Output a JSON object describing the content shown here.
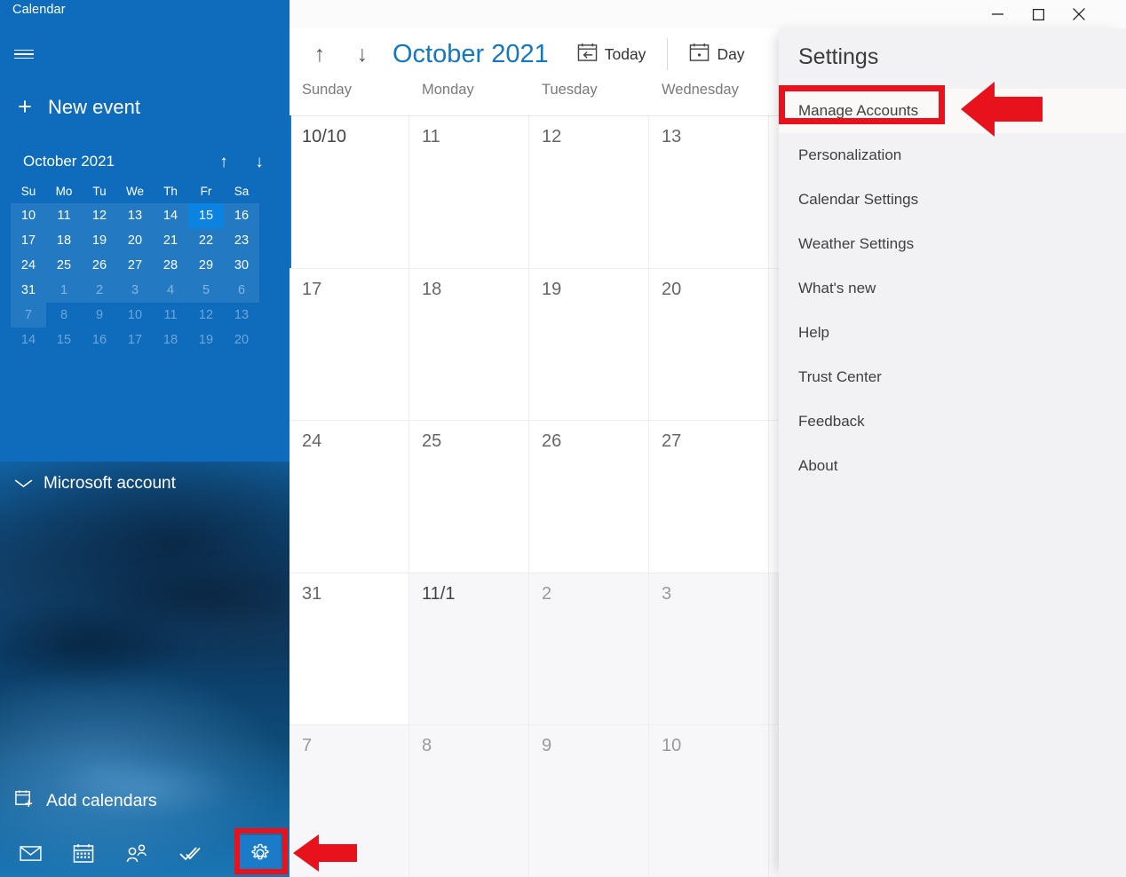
{
  "window": {
    "app_title": "Calendar",
    "controls": {
      "minimize": "—",
      "maximize": "□",
      "close": "✕"
    }
  },
  "sidebar": {
    "hamburger_label": "Menu",
    "new_event": {
      "icon": "plus-icon",
      "label": "New event"
    },
    "mini_calendar": {
      "month_label": "October 2021",
      "prev_icon": "↑",
      "next_icon": "↓",
      "weekday_headers": [
        "Su",
        "Mo",
        "Tu",
        "We",
        "Th",
        "Fr",
        "Sa"
      ],
      "today": "15",
      "weeks": [
        [
          {
            "d": "10",
            "state": "current"
          },
          {
            "d": "11",
            "state": "current"
          },
          {
            "d": "12",
            "state": "current"
          },
          {
            "d": "13",
            "state": "current"
          },
          {
            "d": "14",
            "state": "current"
          },
          {
            "d": "15",
            "state": "today"
          },
          {
            "d": "16",
            "state": "current"
          }
        ],
        [
          {
            "d": "17",
            "state": "current"
          },
          {
            "d": "18",
            "state": "current"
          },
          {
            "d": "19",
            "state": "current"
          },
          {
            "d": "20",
            "state": "current"
          },
          {
            "d": "21",
            "state": "current"
          },
          {
            "d": "22",
            "state": "current"
          },
          {
            "d": "23",
            "state": "current"
          }
        ],
        [
          {
            "d": "24",
            "state": "current"
          },
          {
            "d": "25",
            "state": "current"
          },
          {
            "d": "26",
            "state": "current"
          },
          {
            "d": "27",
            "state": "current"
          },
          {
            "d": "28",
            "state": "current"
          },
          {
            "d": "29",
            "state": "current"
          },
          {
            "d": "30",
            "state": "current"
          }
        ],
        [
          {
            "d": "31",
            "state": "current"
          },
          {
            "d": "1",
            "state": "other"
          },
          {
            "d": "2",
            "state": "other"
          },
          {
            "d": "3",
            "state": "other"
          },
          {
            "d": "4",
            "state": "other"
          },
          {
            "d": "5",
            "state": "other"
          },
          {
            "d": "6",
            "state": "other"
          }
        ],
        [
          {
            "d": "7",
            "state": "faded"
          },
          {
            "d": "8",
            "state": "faded"
          },
          {
            "d": "9",
            "state": "faded"
          },
          {
            "d": "10",
            "state": "faded"
          },
          {
            "d": "11",
            "state": "faded"
          },
          {
            "d": "12",
            "state": "faded"
          },
          {
            "d": "13",
            "state": "faded"
          }
        ],
        [
          {
            "d": "14",
            "state": "faded"
          },
          {
            "d": "15",
            "state": "faded"
          },
          {
            "d": "16",
            "state": "faded"
          },
          {
            "d": "17",
            "state": "faded"
          },
          {
            "d": "18",
            "state": "faded"
          },
          {
            "d": "19",
            "state": "faded"
          },
          {
            "d": "20",
            "state": "faded"
          }
        ]
      ]
    },
    "account_group": {
      "chevron": "⌄",
      "label": "Microsoft account"
    },
    "add_calendars": {
      "icon": "calendar-add-icon",
      "label": "Add calendars"
    },
    "bottom_nav": [
      {
        "name": "mail-icon",
        "label": "Mail",
        "selected": false
      },
      {
        "name": "calendar-icon",
        "label": "Calendar",
        "selected": false
      },
      {
        "name": "people-icon",
        "label": "People",
        "selected": false
      },
      {
        "name": "todo-icon",
        "label": "To Do",
        "selected": false
      },
      {
        "name": "gear-icon",
        "label": "Settings",
        "selected": true
      }
    ]
  },
  "calendar": {
    "toolbar": {
      "prev_icon": "↑",
      "next_icon": "↓",
      "title": "October 2021",
      "today_label": "Today",
      "view_label": "Day"
    },
    "weekday_headers": [
      "Sunday",
      "Monday",
      "Tuesday",
      "Wednesday"
    ],
    "weeks": [
      [
        {
          "d": "10/10",
          "off": false
        },
        {
          "d": "11",
          "off": false
        },
        {
          "d": "12",
          "off": false
        },
        {
          "d": "13",
          "off": false
        }
      ],
      [
        {
          "d": "17",
          "off": false
        },
        {
          "d": "18",
          "off": false
        },
        {
          "d": "19",
          "off": false
        },
        {
          "d": "20",
          "off": false
        }
      ],
      [
        {
          "d": "24",
          "off": false
        },
        {
          "d": "25",
          "off": false
        },
        {
          "d": "26",
          "off": false
        },
        {
          "d": "27",
          "off": false
        }
      ],
      [
        {
          "d": "31",
          "off": false
        },
        {
          "d": "11/1",
          "off": true
        },
        {
          "d": "2",
          "off": true
        },
        {
          "d": "3",
          "off": true
        }
      ],
      [
        {
          "d": "7",
          "off": true
        },
        {
          "d": "8",
          "off": true
        },
        {
          "d": "9",
          "off": true
        },
        {
          "d": "10",
          "off": true
        }
      ]
    ]
  },
  "settings_panel": {
    "title": "Settings",
    "items": [
      {
        "label": "Manage Accounts",
        "highlighted": true
      },
      {
        "label": "Personalization",
        "highlighted": false
      },
      {
        "label": "Calendar Settings",
        "highlighted": false
      },
      {
        "label": "Weather Settings",
        "highlighted": false
      },
      {
        "label": "What's new",
        "highlighted": false
      },
      {
        "label": "Help",
        "highlighted": false
      },
      {
        "label": "Trust Center",
        "highlighted": false
      },
      {
        "label": "Feedback",
        "highlighted": false
      },
      {
        "label": "About",
        "highlighted": false
      }
    ]
  },
  "annotations": {
    "highlight_color": "#e8121d",
    "boxes": [
      {
        "name": "manage-accounts-highlight-box",
        "target": "Manage Accounts"
      },
      {
        "name": "settings-gear-highlight-box",
        "target": "Settings gear icon"
      }
    ],
    "arrows": [
      {
        "name": "arrow-pointing-to-manage-accounts",
        "direction": "left"
      },
      {
        "name": "arrow-pointing-to-settings-gear",
        "direction": "left"
      }
    ]
  },
  "colors": {
    "sidebar_blue": "#0f6cbd",
    "accent_blue": "#1277c4",
    "today_blue": "#0a84e0",
    "settings_bg": "#f2f1f4",
    "annotation_red": "#e8121d"
  }
}
